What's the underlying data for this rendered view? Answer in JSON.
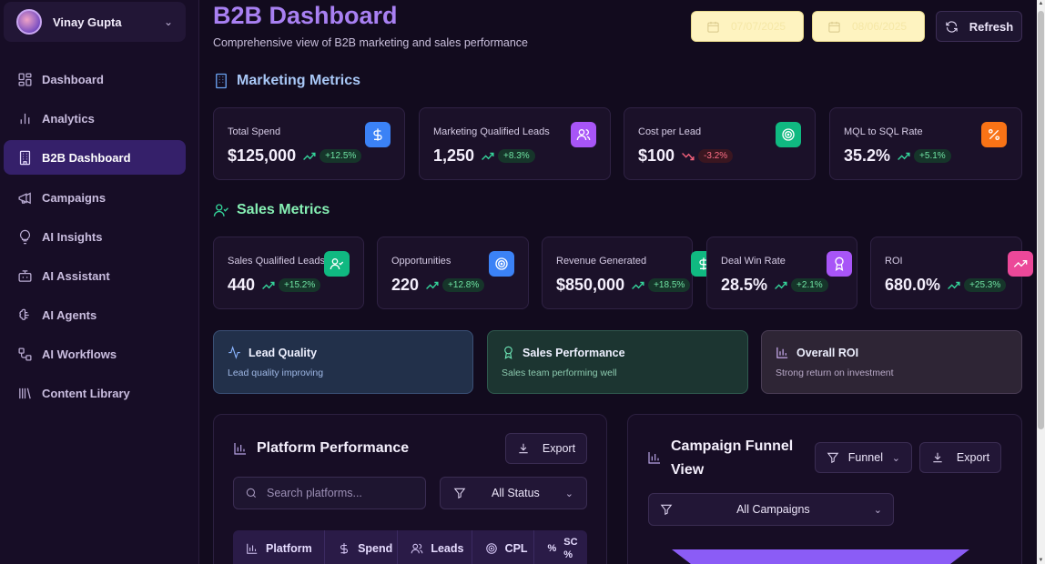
{
  "user": {
    "name": "Vinay Gupta"
  },
  "nav": [
    {
      "label": "Dashboard",
      "icon": "layout-grid-icon"
    },
    {
      "label": "Analytics",
      "icon": "bar-chart-icon"
    },
    {
      "label": "B2B Dashboard",
      "icon": "building-icon",
      "active": true
    },
    {
      "label": "Campaigns",
      "icon": "megaphone-icon"
    },
    {
      "label": "AI Insights",
      "icon": "lightbulb-icon"
    },
    {
      "label": "AI Assistant",
      "icon": "bot-icon"
    },
    {
      "label": "AI Agents",
      "icon": "brain-icon"
    },
    {
      "label": "AI Workflows",
      "icon": "workflow-icon"
    },
    {
      "label": "Content Library",
      "icon": "library-icon"
    }
  ],
  "header": {
    "title": "B2B Dashboard",
    "subtitle": "Comprehensive view of B2B marketing and sales performance",
    "date_from": "07/07/2025",
    "date_to": "08/06/2025",
    "refresh_label": "Refresh"
  },
  "marketing": {
    "title": "Marketing Metrics",
    "cards": [
      {
        "label": "Total Spend",
        "value": "$125,000",
        "change": "+12.5%",
        "trend": "up",
        "icon": "dollar-icon",
        "color": "#3b82f6"
      },
      {
        "label": "Marketing Qualified Leads",
        "value": "1,250",
        "change": "+8.3%",
        "trend": "up",
        "icon": "users-icon",
        "color": "#a855f7"
      },
      {
        "label": "Cost per Lead",
        "value": "$100",
        "change": "-3.2%",
        "trend": "down",
        "icon": "target-icon",
        "color": "#10b981"
      },
      {
        "label": "MQL to SQL Rate",
        "value": "35.2%",
        "change": "+5.1%",
        "trend": "up",
        "icon": "percent-icon",
        "color": "#f97316"
      }
    ]
  },
  "sales": {
    "title": "Sales Metrics",
    "cards": [
      {
        "label": "Sales Qualified Leads",
        "value": "440",
        "change": "+15.2%",
        "trend": "up",
        "icon": "user-check-icon",
        "color": "#10b981"
      },
      {
        "label": "Opportunities",
        "value": "220",
        "change": "+12.8%",
        "trend": "up",
        "icon": "target-icon",
        "color": "#3b82f6"
      },
      {
        "label": "Revenue Generated",
        "value": "$850,000",
        "change": "+18.5%",
        "trend": "up",
        "icon": "dollar-icon",
        "color": "#10b981"
      },
      {
        "label": "Deal Win Rate",
        "value": "28.5%",
        "change": "+2.1%",
        "trend": "up",
        "icon": "award-icon",
        "color": "#a855f7"
      },
      {
        "label": "ROI",
        "value": "680.0%",
        "change": "+25.3%",
        "trend": "up",
        "icon": "trending-up-icon",
        "color": "#ec4899"
      }
    ]
  },
  "insights": [
    {
      "title": "Lead Quality",
      "subtitle": "Lead quality improving",
      "icon": "activity-icon"
    },
    {
      "title": "Sales Performance",
      "subtitle": "Sales team performing well",
      "icon": "award-icon"
    },
    {
      "title": "Overall ROI",
      "subtitle": "Strong return on investment",
      "icon": "bar-chart-icon"
    }
  ],
  "platform": {
    "title": "Platform Performance",
    "export_label": "Export",
    "search_placeholder": "Search platforms...",
    "status_filter": "All Status",
    "columns": [
      "Platform",
      "Spend",
      "Leads",
      "CPL",
      "SC %"
    ]
  },
  "funnel": {
    "title_line1": "Campaign Funnel",
    "title_line2": "View",
    "type_label": "Funnel",
    "export_label": "Export",
    "campaign_filter": "All Campaigns"
  }
}
